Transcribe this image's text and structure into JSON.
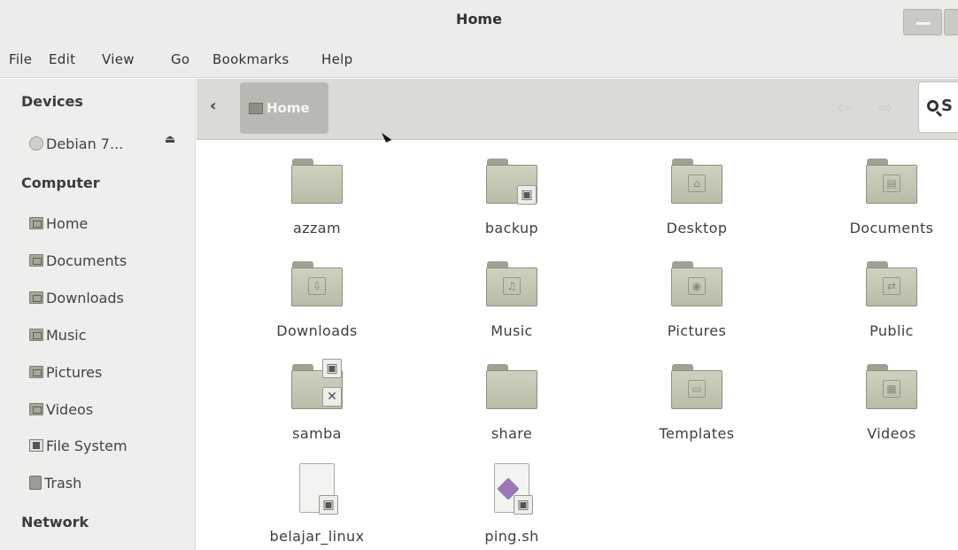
{
  "window": {
    "title": "Home"
  },
  "menu": [
    "File",
    "Edit",
    "View",
    "Go",
    "Bookmarks",
    "Help"
  ],
  "sidebar": {
    "devices_heading": "Devices",
    "devices": [
      {
        "label": "Debian 7...",
        "icon": "disc-icon"
      }
    ],
    "computer_heading": "Computer",
    "computer": [
      {
        "label": "Home",
        "icon": "home-folder-icon"
      },
      {
        "label": "Documents",
        "icon": "documents-folder-icon"
      },
      {
        "label": "Downloads",
        "icon": "downloads-folder-icon"
      },
      {
        "label": "Music",
        "icon": "music-folder-icon"
      },
      {
        "label": "Pictures",
        "icon": "pictures-folder-icon"
      },
      {
        "label": "Videos",
        "icon": "videos-folder-icon"
      },
      {
        "label": "File System",
        "icon": "filesystem-icon"
      },
      {
        "label": "Trash",
        "icon": "trash-icon"
      }
    ],
    "network_heading": "Network"
  },
  "toolbar": {
    "path_label": "Home",
    "search_text": "S"
  },
  "files": [
    {
      "name": "azzam",
      "type": "folder",
      "emblem": ""
    },
    {
      "name": "backup",
      "type": "folder",
      "emblem": "lock"
    },
    {
      "name": "Desktop",
      "type": "folder",
      "emblem": "desktop"
    },
    {
      "name": "Documents",
      "type": "folder",
      "emblem": "document"
    },
    {
      "name": "Downloads",
      "type": "folder",
      "emblem": "download"
    },
    {
      "name": "Music",
      "type": "folder",
      "emblem": "music"
    },
    {
      "name": "Pictures",
      "type": "folder",
      "emblem": "camera"
    },
    {
      "name": "Public",
      "type": "folder",
      "emblem": "share"
    },
    {
      "name": "samba",
      "type": "folder",
      "emblem": "lock-unreadable"
    },
    {
      "name": "share",
      "type": "folder",
      "emblem": ""
    },
    {
      "name": "Templates",
      "type": "folder",
      "emblem": "template"
    },
    {
      "name": "Videos",
      "type": "folder",
      "emblem": "film"
    },
    {
      "name": "belajar_linux",
      "type": "file",
      "emblem": "lock"
    },
    {
      "name": "ping.sh",
      "type": "script",
      "emblem": "lock"
    }
  ]
}
